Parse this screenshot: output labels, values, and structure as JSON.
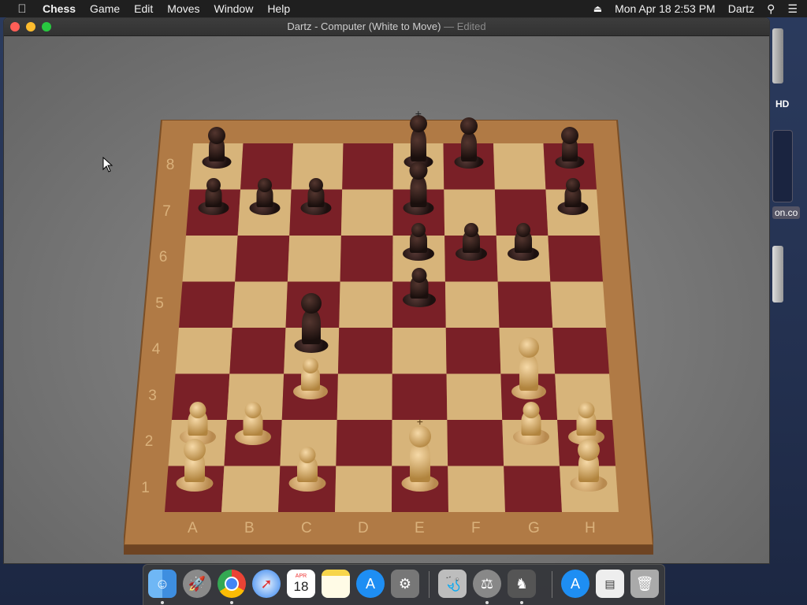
{
  "menubar": {
    "app_name": "Chess",
    "menus": [
      "Game",
      "Edit",
      "Moves",
      "Window",
      "Help"
    ],
    "datetime": "Mon Apr 18  2:53 PM",
    "user": "Dartz"
  },
  "window": {
    "title_main": "Dartz - Computer   (White to Move)",
    "title_edited": "— Edited"
  },
  "board": {
    "ranks": [
      "8",
      "7",
      "6",
      "5",
      "4",
      "3",
      "2",
      "1"
    ],
    "files": [
      "A",
      "B",
      "C",
      "D",
      "E",
      "F",
      "G",
      "H"
    ],
    "light_color": "#d7b47a",
    "dark_color": "#7a2027",
    "frame_color": "#b07a45"
  },
  "desktop": {
    "hd_label": "HD",
    "site_label": "on.co"
  },
  "dock": {
    "calendar_month": "APR",
    "calendar_day": "18"
  }
}
